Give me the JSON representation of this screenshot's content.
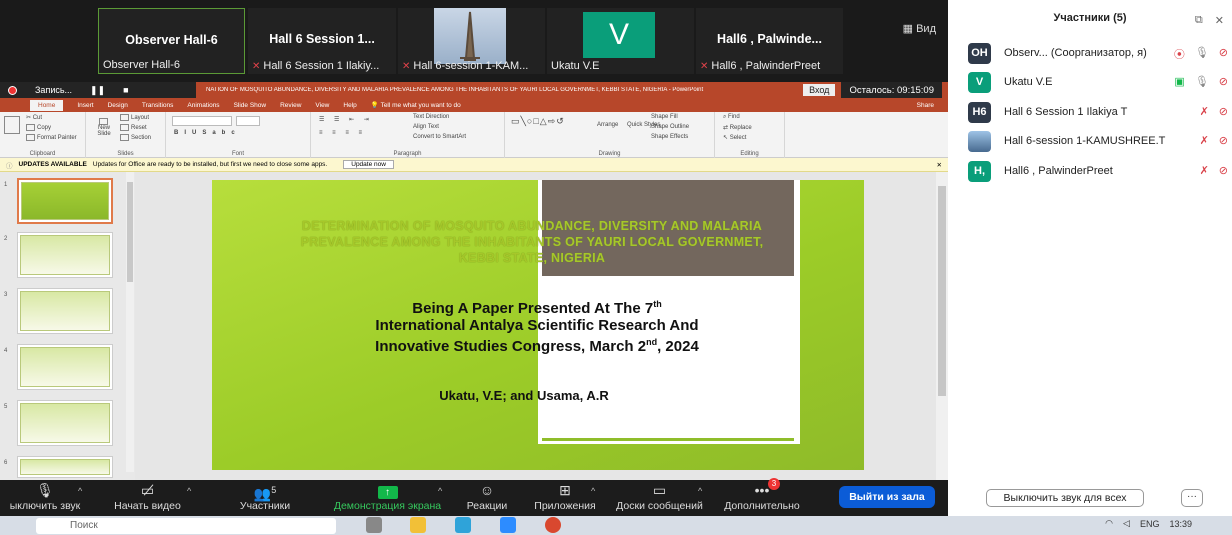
{
  "window": {
    "view_label": "Вид"
  },
  "tiles": [
    {
      "name": "Observer Hall-6",
      "label": "Observer Hall-6",
      "muted": false
    },
    {
      "name": "Hall 6 Session 1...",
      "label": "Hall 6 Session 1 Ilakiy...",
      "muted": true
    },
    {
      "name": "",
      "label": "Hall 6-session 1-KAM...",
      "muted": true
    },
    {
      "name": "V",
      "label": "Ukatu V.E",
      "muted": false
    },
    {
      "name": "Hall6 , Palwinde...",
      "label": "Hall6 , PalwinderPreet",
      "muted": true
    }
  ],
  "recording": {
    "label": "Запись...",
    "enter_label": "Вход",
    "remaining": "Осталось: 09:15:09"
  },
  "ppt": {
    "window_title": "NATION OF MOSQUITO ABUNDANCE, DIVERSITY AND MALARIA PREVALENCE AMONG THE INHABITANTS OF YAURI LOCAL GOVERNMET, KEBBI STATE, NIGERIA  -  PowerPoint",
    "tabs": [
      "Home",
      "Insert",
      "Design",
      "Transitions",
      "Animations",
      "Slide Show",
      "Review",
      "View",
      "Help",
      "Tell me what you want to do",
      "Share"
    ],
    "groups": [
      "Clipboard",
      "Slides",
      "Font",
      "Paragraph",
      "Drawing",
      "Editing"
    ],
    "ribbon_items": {
      "cut": "Cut",
      "copy": "Copy",
      "format_painter": "Format Painter",
      "new_slide": "New Slide",
      "layout": "Layout",
      "reset": "Reset",
      "section": "Section",
      "text_direction": "Text Direction",
      "align_text": "Align Text",
      "convert": "Convert to SmartArt",
      "arrange": "Arrange",
      "quick_styles": "Quick Styles",
      "shape_fill": "Shape Fill",
      "shape_outline": "Shape Outline",
      "shape_effects": "Shape Effects",
      "find": "Find",
      "replace": "Replace",
      "select": "Select"
    },
    "update": {
      "title": "UPDATES AVAILABLE",
      "message": "Updates for Office are ready to be installed, but first we need to close some apps.",
      "button": "Update now"
    },
    "thumb_numbers": [
      "1",
      "2",
      "3",
      "4",
      "5",
      "6"
    ],
    "slide": {
      "title": "DETERMINATION OF MOSQUITO ABUNDANCE, DIVERSITY AND MALARIA PREVALENCE AMONG THE INHABITANTS OF YAURI LOCAL GOVERNMET, KEBBI STATE, NIGERIA",
      "sub_line1_a": "Being A Paper Presented At The 7",
      "sub_line1_sup": "th",
      "sub_line2": "International Antalya Scientific Research And",
      "sub_line3_a": "Innovative Studies Congress, March 2",
      "sub_line3_sup": "nd",
      "sub_line3_b": ", 2024",
      "authors": "Ukatu, V.E; and Usama, A.R"
    }
  },
  "toolbar": {
    "mute": "ыключить звук",
    "video": "Начать видео",
    "participants": "Участники",
    "participants_count": "5",
    "share": "Демонстрация экрана",
    "reactions": "Реакции",
    "apps": "Приложения",
    "whiteboards": "Доски сообщений",
    "more": "Дополнительно",
    "more_badge": "3",
    "leave": "Выйти из зала"
  },
  "panel": {
    "title": "Участники (5)",
    "participants": [
      {
        "initials": "OH",
        "name": "Observ...  (Соорганизатор, я)",
        "color": "#2f3a4a"
      },
      {
        "initials": "V",
        "name": "Ukatu V.E",
        "color": "#0a9e7a"
      },
      {
        "initials": "H6",
        "name": "Hall 6 Session 1 Ilakiya T",
        "color": "#2f3a4a"
      },
      {
        "initials": "",
        "name": "Hall 6-session 1-KAMUSHREE.T",
        "color": "#6a8fb8"
      },
      {
        "initials": "H,",
        "name": "Hall6 , PalwinderPreet",
        "color": "#0a9e7a"
      }
    ],
    "mute_all": "Выключить звук для всех",
    "more": "···"
  },
  "taskbar": {
    "search": "Поиск",
    "lang": "ENG",
    "time": "13:39"
  },
  "colors": {
    "ppt_accent": "#b7472a",
    "zoom_bg": "#1a1a1a",
    "leave": "#0b5cd7",
    "slide_green": "#9ccc28"
  }
}
